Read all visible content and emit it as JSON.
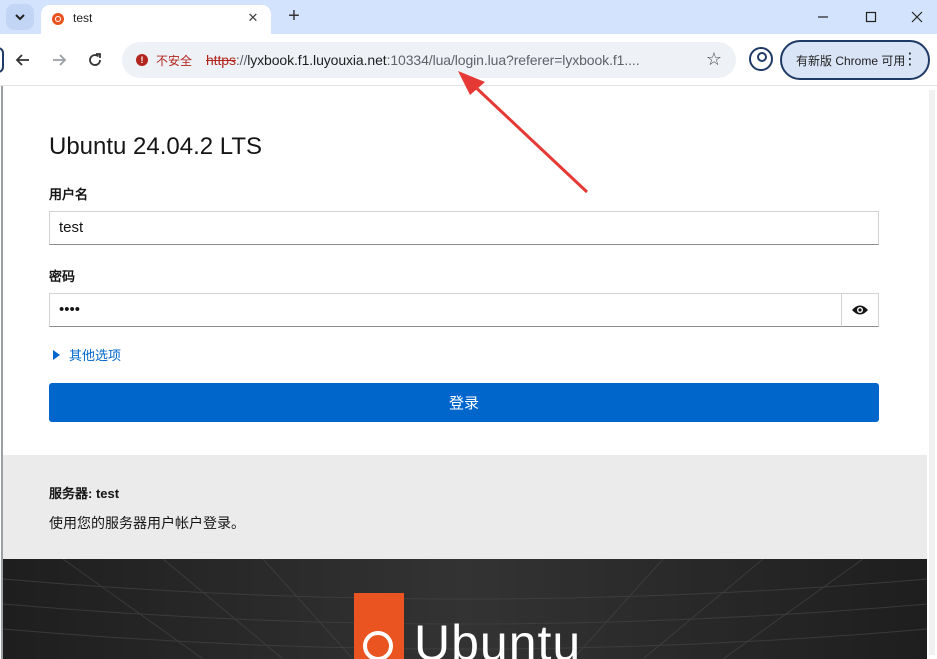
{
  "browser": {
    "tab_title": "test",
    "security_label": "不安全",
    "url_scheme": "https",
    "url_separator": "://",
    "url_host": "lyxbook.f1.luyouxia.net",
    "url_rest": ":10334/lua/login.lua?referer=lyxbook.f1....",
    "update_label": "有新版 Chrome 可用"
  },
  "login": {
    "title": "Ubuntu 24.04.2 LTS",
    "username_label": "用户名",
    "username_value": "test",
    "password_label": "密码",
    "password_value": "••••",
    "more_options": "其他选项",
    "login_button": "登录"
  },
  "info": {
    "server_label": "服务器: test",
    "hint": "使用您的服务器用户帐户登录。"
  },
  "brand": {
    "logo_text": "Ubuntu"
  },
  "colors": {
    "accent": "#0066cc",
    "ubuntu_orange": "#e95420",
    "annotation_arrow": "#e53935"
  }
}
